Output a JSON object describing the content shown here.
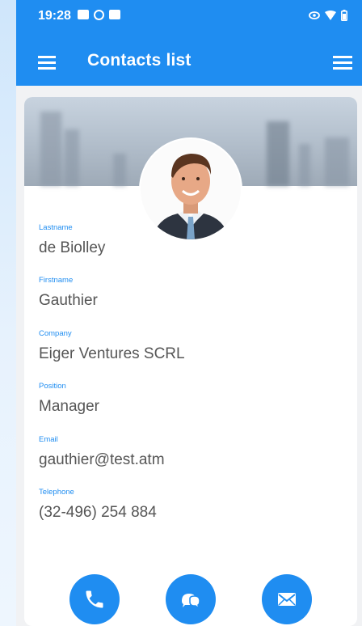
{
  "status": {
    "time": "19:28"
  },
  "header": {
    "title": "Contacts list"
  },
  "contact": {
    "fields": [
      {
        "label": "Lastname",
        "value": "de Biolley"
      },
      {
        "label": "Firstname",
        "value": "Gauthier"
      },
      {
        "label": "Company",
        "value": "Eiger Ventures SCRL"
      },
      {
        "label": "Position",
        "value": "Manager"
      },
      {
        "label": "Email",
        "value": "gauthier@test.atm"
      },
      {
        "label": "Telephone",
        "value": "(32-496) 254 884"
      }
    ]
  },
  "actions": [
    {
      "icon": "phone-icon"
    },
    {
      "icon": "chat-icon"
    },
    {
      "icon": "mail-icon"
    }
  ],
  "colors": {
    "primary": "#1f8df1"
  }
}
